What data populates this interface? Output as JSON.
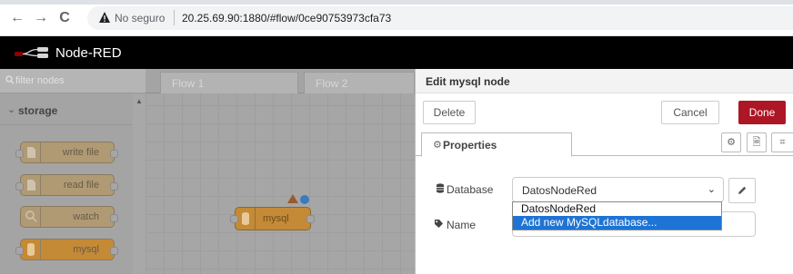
{
  "browser": {
    "back": "←",
    "forward": "→",
    "reload": "C",
    "not_secure": "No seguro",
    "url": "20.25.69.90:1880/#flow/0ce90753973cfa73"
  },
  "app": {
    "title": "Node-RED"
  },
  "palette": {
    "filter_placeholder": "filter nodes",
    "category": "storage",
    "nodes": [
      {
        "label": "write file"
      },
      {
        "label": "read file"
      },
      {
        "label": "watch"
      },
      {
        "label": "mysql"
      }
    ]
  },
  "workspace": {
    "tabs": [
      "Flow 1",
      "Flow 2"
    ],
    "node_label": "mysql"
  },
  "tray": {
    "title": "Edit mysql node",
    "delete_label": "Delete",
    "cancel_label": "Cancel",
    "done_label": "Done",
    "properties_tab": "Properties",
    "database_label": "Database",
    "database_value": "DatosNodeRed",
    "name_label": "Name",
    "dropdown_options": [
      "DatosNodeRed",
      "Add new MySQLdatabase..."
    ]
  },
  "colors": {
    "done_button": "#ad1625",
    "storage_node": "#c48a36",
    "selected_option": "#1e74d4"
  }
}
